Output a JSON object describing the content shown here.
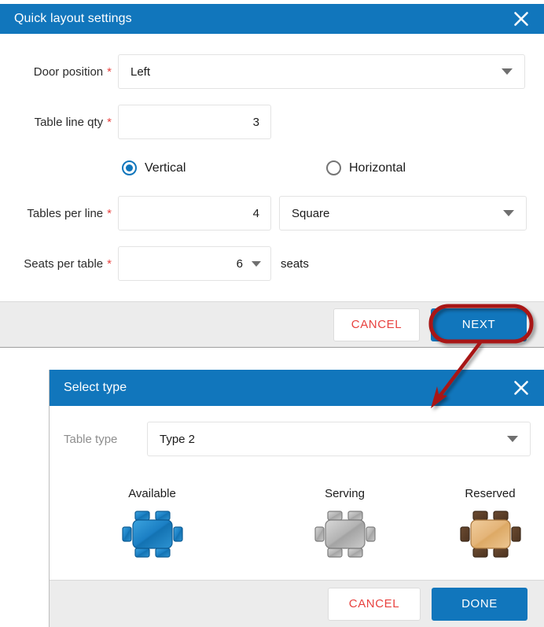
{
  "dialog1": {
    "title": "Quick layout settings",
    "close_icon": "close-x-icon",
    "fields": {
      "door_position": {
        "label": "Door position",
        "required": "*",
        "value": "Left",
        "caret_icon": "chevron-down-icon"
      },
      "table_line_qty": {
        "label": "Table line qty",
        "required": "*",
        "value": "3"
      },
      "tables_per_line": {
        "label": "Tables per line",
        "required": "*",
        "value": "4"
      },
      "table_shape": {
        "value": "Square",
        "caret_icon": "chevron-down-icon"
      },
      "seats_per_table": {
        "label": "Seats per table",
        "required": "*",
        "value": "6",
        "suffix": "seats",
        "caret_icon": "chevron-down-icon"
      }
    },
    "orientation": {
      "vertical": {
        "label": "Vertical",
        "selected": true
      },
      "horizontal": {
        "label": "Horizontal",
        "selected": false
      }
    },
    "buttons": {
      "cancel": "CANCEL",
      "next": "NEXT"
    }
  },
  "dialog2": {
    "title": "Select type",
    "close_icon": "close-x-icon",
    "table_type": {
      "label": "Table type",
      "value": "Type 2",
      "caret_icon": "chevron-down-icon"
    },
    "types": [
      {
        "name": "Available",
        "icon": "table-6-seats-icon",
        "color": "#1b7fc4"
      },
      {
        "name": "Serving",
        "icon": "table-6-seats-icon",
        "color": "#a9a9a9"
      },
      {
        "name": "Reserved",
        "icon": "table-6-seats-icon",
        "color": "#e2b277"
      }
    ],
    "buttons": {
      "cancel": "CANCEL",
      "done": "DONE"
    }
  },
  "annotation": {
    "highlight_shape": "oval-highlight",
    "arrow": "pointer-arrow",
    "color": "#a81916"
  },
  "theme": {
    "accent": "#1176bc",
    "required_red": "#e8423f",
    "footer_bg": "#ececec"
  }
}
